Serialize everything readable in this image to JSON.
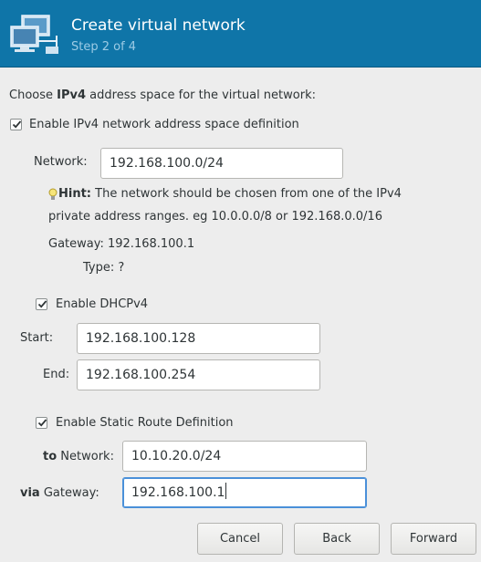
{
  "header": {
    "title": "Create virtual network",
    "step": "Step 2 of 4"
  },
  "intro": {
    "prefix": "Choose ",
    "bold": "IPv4",
    "suffix": " address space for the virtual network:"
  },
  "ipv4": {
    "enable_label": "Enable IPv4 network address space definition",
    "enabled": true,
    "network_label": "Network:",
    "network_value": "192.168.100.0/24",
    "hint_bold": "Hint:",
    "hint_line1": " The network should be chosen from one of the IPv4",
    "hint_line2": "private address ranges. eg 10.0.0.0/8 or 192.168.0.0/16",
    "gateway_label": "Gateway: 192.168.100.1",
    "type_label": "Type: ?"
  },
  "dhcp": {
    "enable_label": "Enable DHCPv4",
    "enabled": true,
    "start_label": "Start:",
    "start_value": "192.168.100.128",
    "end_label": "End:",
    "end_value": "192.168.100.254"
  },
  "static_route": {
    "enable_label": "Enable Static Route Definition",
    "enabled": true,
    "to_bold": "to",
    "to_rest": " Network:",
    "to_value": "10.10.20.0/24",
    "via_bold": "via",
    "via_rest": " Gateway:",
    "via_value": "192.168.100.1"
  },
  "buttons": {
    "cancel": "Cancel",
    "back": "Back",
    "forward": "Forward"
  },
  "icons": {
    "header": "virtual-network-icon",
    "hint": "lightbulb-icon",
    "check": "checkmark-icon"
  },
  "colors": {
    "header_bg": "#0f75a8",
    "header_step": "#9ccbe5",
    "focus": "#4a90d9",
    "window_bg": "#ededed"
  }
}
